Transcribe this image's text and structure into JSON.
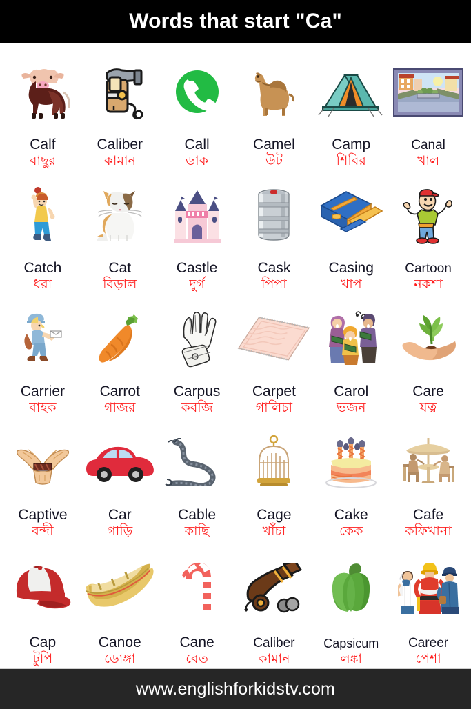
{
  "header": {
    "title": "Words that start \"Ca\""
  },
  "footer": {
    "website": "www.englishforkidstv.com"
  },
  "colors": {
    "header_bg": "#000000",
    "footer_bg": "#262626",
    "page_bg": "#ffffff",
    "english_text": "#151525",
    "bengali_text": "#ff1e1e"
  },
  "rows": [
    {
      "cells": [
        {
          "en": "Calf",
          "bn": "বাছুর",
          "icon": "calf-icon"
        },
        {
          "en": "Caliber",
          "bn": "কামান",
          "icon": "caliber-gun-icon"
        },
        {
          "en": "Call",
          "bn": "ডাক",
          "icon": "phone-call-icon"
        },
        {
          "en": "Camel",
          "bn": "উট",
          "icon": "camel-icon"
        },
        {
          "en": "Camp",
          "bn": "শিবির",
          "icon": "tent-icon"
        },
        {
          "en": "Canal",
          "bn": "খাল",
          "icon": "canal-photo-icon"
        }
      ]
    },
    {
      "cells": [
        {
          "en": "Catch",
          "bn": "ধরা",
          "icon": "boy-catching-ball-icon"
        },
        {
          "en": "Cat",
          "bn": "বিড়াল",
          "icon": "cat-icon"
        },
        {
          "en": "Castle",
          "bn": "দুর্গ",
          "icon": "castle-icon"
        },
        {
          "en": "Cask",
          "bn": "পিপা",
          "icon": "cask-barrel-icon"
        },
        {
          "en": "Casing",
          "bn": "খাপ",
          "icon": "pencil-case-icon"
        },
        {
          "en": "Cartoon",
          "bn": "নকশা",
          "icon": "cartoon-boy-icon"
        }
      ]
    },
    {
      "cells": [
        {
          "en": "Carrier",
          "bn": "বাহক",
          "icon": "mail-carrier-icon"
        },
        {
          "en": "Carrot",
          "bn": "গাজর",
          "icon": "carrot-icon"
        },
        {
          "en": "Carpus",
          "bn": "কবজি",
          "icon": "wrist-hand-icon"
        },
        {
          "en": "Carpet",
          "bn": "গালিচা",
          "icon": "carpet-icon"
        },
        {
          "en": "Carol",
          "bn": "ভজন",
          "icon": "carol-singers-icon"
        },
        {
          "en": "Care",
          "bn": "যত্ন",
          "icon": "hand-plant-icon"
        }
      ]
    },
    {
      "cells": [
        {
          "en": "Captive",
          "bn": "বন্দী",
          "icon": "tied-hands-icon"
        },
        {
          "en": "Car",
          "bn": "গাড়ি",
          "icon": "car-icon"
        },
        {
          "en": "Cable",
          "bn": "কাছি",
          "icon": "cable-wire-icon"
        },
        {
          "en": "Cage",
          "bn": "খাঁচা",
          "icon": "birdcage-icon"
        },
        {
          "en": "Cake",
          "bn": "কেক",
          "icon": "birthday-cake-icon"
        },
        {
          "en": "Cafe",
          "bn": "কফিখানা",
          "icon": "cafe-table-icon"
        }
      ]
    },
    {
      "cells": [
        {
          "en": "Cap",
          "bn": "টুপি",
          "icon": "baseball-cap-icon"
        },
        {
          "en": "Canoe",
          "bn": "ডোঙ্গা",
          "icon": "canoe-icon"
        },
        {
          "en": "Cane",
          "bn": "বেত",
          "icon": "candy-cane-icon"
        },
        {
          "en": "Caliber",
          "bn": "কামান",
          "icon": "cannon-icon"
        },
        {
          "en": "Capsicum",
          "bn": "লঙ্কা",
          "icon": "bell-pepper-icon"
        },
        {
          "en": "Career",
          "bn": "পেশা",
          "icon": "professionals-icon"
        }
      ]
    }
  ]
}
